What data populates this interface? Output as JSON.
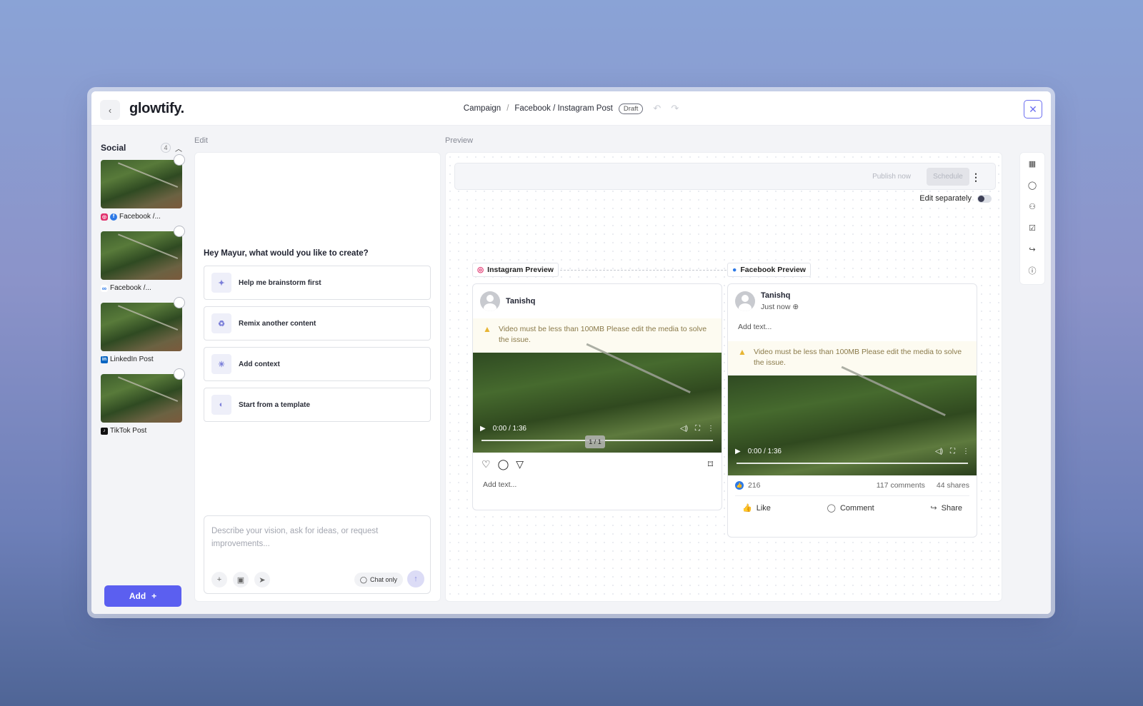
{
  "topbar": {
    "back_icon": "‹",
    "logo": "glowtify.",
    "breadcrumb_root": "Campaign",
    "breadcrumb_sep": "/",
    "breadcrumb_current": "Facebook / Instagram Post",
    "status_badge": "Draft",
    "close_icon": "✕"
  },
  "sidebar": {
    "title": "Social",
    "count": "4",
    "posts": [
      {
        "label": "Facebook /...",
        "icons": [
          "instagram",
          "facebook"
        ]
      },
      {
        "label": "Facebook /...",
        "icons": [
          "meta"
        ]
      },
      {
        "label": "LinkedIn Post",
        "icons": [
          "linkedin"
        ]
      },
      {
        "label": "TikTok Post",
        "icons": [
          "tiktok"
        ]
      }
    ],
    "add_label": "Add",
    "add_icon": "+"
  },
  "edit": {
    "section_label": "Edit",
    "greeting": "Hey Mayur, what would you like to create?",
    "options": [
      {
        "label": "Help me brainstorm first",
        "icon": "sparkle-icon"
      },
      {
        "label": "Remix another content",
        "icon": "recycle-icon"
      },
      {
        "label": "Add context",
        "icon": "lightbulb-icon"
      },
      {
        "label": "Start from a template",
        "icon": "palette-icon"
      }
    ],
    "composer_placeholder": "Describe your vision, ask for ideas, or request improvements...",
    "chat_only_label": "Chat only"
  },
  "preview": {
    "section_label": "Preview",
    "publish_now": "Publish now",
    "schedule": "Schedule",
    "edit_separately": "Edit separately",
    "instagram": {
      "tag": "Instagram Preview",
      "username": "Tanishq",
      "warning": "Video must be less than 100MB Please edit the media to solve the issue.",
      "time": "0:00 / 1:36",
      "pager": "1 / 1",
      "add_text": "Add text..."
    },
    "facebook": {
      "tag": "Facebook Preview",
      "username": "Tanishq",
      "meta": "Just now",
      "add_text": "Add text...",
      "warning": "Video must be less than 100MB Please edit the media to solve the issue.",
      "time": "0:00 / 1:36",
      "likes": "216",
      "comments": "117 comments",
      "shares": "44 shares",
      "like_label": "Like",
      "comment_label": "Comment",
      "share_label": "Share"
    }
  },
  "colors": {
    "accent": "#5b5ff0",
    "facebook": "#2d79e6",
    "instagram": "#e1306c",
    "warning": "#e7b534"
  }
}
